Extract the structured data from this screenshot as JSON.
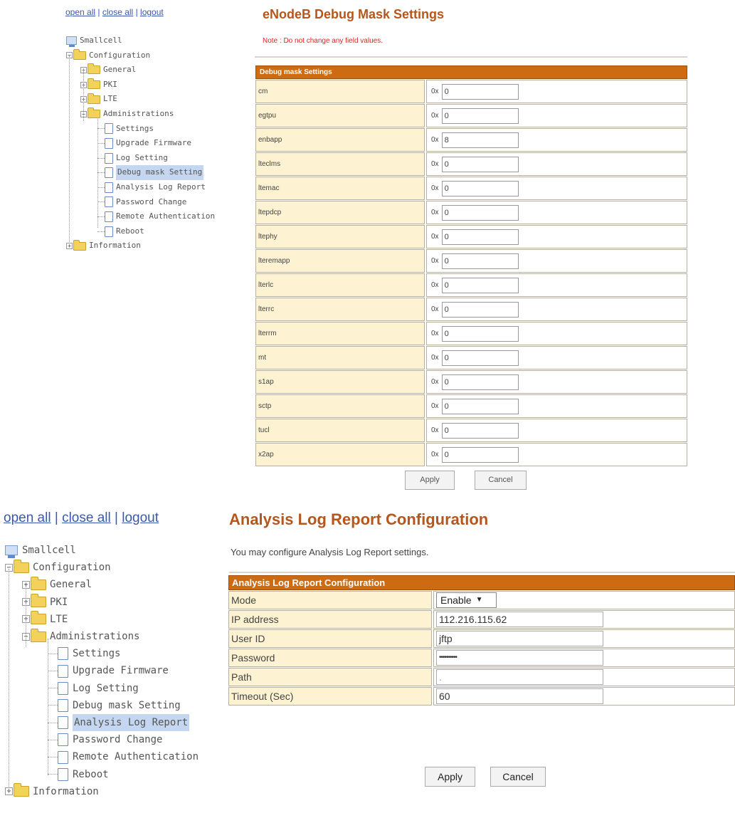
{
  "nav": {
    "open_all": "open all",
    "close_all": "close all",
    "logout": "logout",
    "separator": "|"
  },
  "tree": {
    "root": "Smallcell",
    "configuration": "Configuration",
    "general": "General",
    "pki": "PKI",
    "lte": "LTE",
    "administrations": "Administrations",
    "settings": "Settings",
    "upgrade_firmware": "Upgrade Firmware",
    "log_setting": "Log Setting",
    "debug_mask_setting": "Debug mask Setting",
    "analysis_log_report": "Analysis Log Report",
    "password_change": "Password Change",
    "remote_authentication": "Remote Authentication",
    "reboot": "Reboot",
    "information": "Information",
    "plus": "+",
    "minus": "−"
  },
  "debug_page": {
    "title": "eNodeB Debug Mask Settings",
    "note": "Note : Do not change any field values.",
    "table_header": "Debug mask Settings",
    "prefix": "0x",
    "rows": [
      {
        "label": "cm",
        "value": "0"
      },
      {
        "label": "egtpu",
        "value": "0"
      },
      {
        "label": "enbapp",
        "value": "8"
      },
      {
        "label": "lteclms",
        "value": "0"
      },
      {
        "label": "ltemac",
        "value": "0"
      },
      {
        "label": "ltepdcp",
        "value": "0"
      },
      {
        "label": "ltephy",
        "value": "0"
      },
      {
        "label": "lteremapp",
        "value": "0"
      },
      {
        "label": "lterlc",
        "value": "0"
      },
      {
        "label": "lterrc",
        "value": "0"
      },
      {
        "label": "lterrm",
        "value": "0"
      },
      {
        "label": "mt",
        "value": "0"
      },
      {
        "label": "s1ap",
        "value": "0"
      },
      {
        "label": "sctp",
        "value": "0"
      },
      {
        "label": "tucl",
        "value": "0"
      },
      {
        "label": "x2ap",
        "value": "0"
      }
    ],
    "apply": "Apply",
    "cancel": "Cancel"
  },
  "analysis_page": {
    "title": "Analysis Log Report Configuration",
    "description": "You may configure Analysis Log Report settings.",
    "table_header": "Analysis Log Report Configuration",
    "mode_label": "Mode",
    "mode_value": "Enable",
    "ip_label": "IP address",
    "ip_value": "112.216.115.62",
    "user_label": "User ID",
    "user_value": "jftp",
    "password_label": "Password",
    "password_value": "••••••••••",
    "path_label": "Path",
    "path_value": ".",
    "timeout_label": "Timeout (Sec)",
    "timeout_value": "60",
    "apply": "Apply",
    "cancel": "Cancel"
  },
  "colors": {
    "accent": "#cc6b12",
    "title": "#b5561c",
    "label_bg": "#fdf3d2",
    "note": "#e21f1f",
    "link": "#3b57b0",
    "highlight": "#c5d6f0"
  }
}
